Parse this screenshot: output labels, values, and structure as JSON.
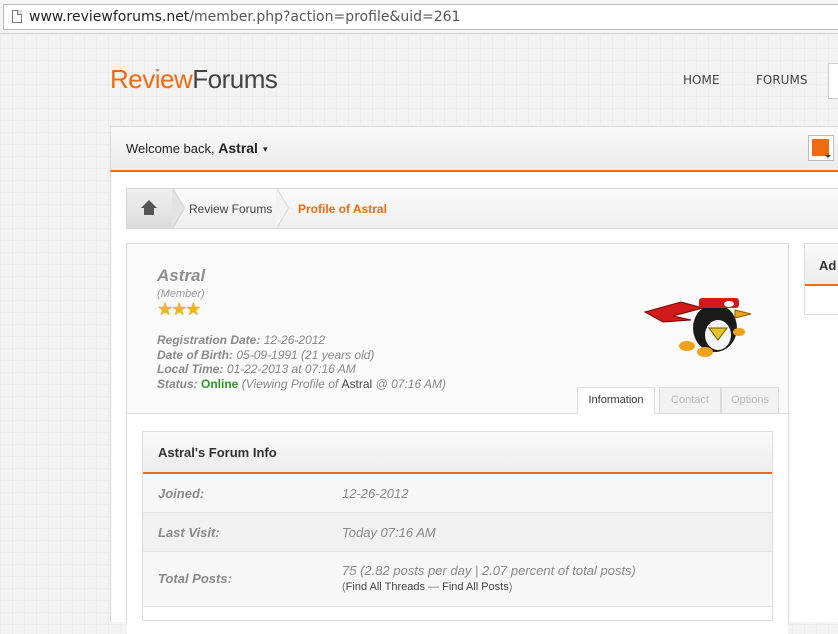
{
  "browser": {
    "url_host": "www.reviewforums.net",
    "url_path": "/member.php?action=profile&uid=261"
  },
  "site": {
    "logo_part1": "Review",
    "logo_part2": "Forums",
    "nav": [
      "HOME",
      "FORUMS"
    ],
    "accent_color": "#f26a10"
  },
  "welcome": {
    "prefix": "Welcome back,",
    "username": "Astral",
    "caret": "▾"
  },
  "breadcrumb": {
    "items": [
      "Review Forums",
      "Profile of Astral"
    ]
  },
  "profile": {
    "name": "Astral",
    "rank": "(Member)",
    "stars": "★★★",
    "star_count": 3,
    "registration_label": "Registration Date:",
    "registration_value": "12-26-2012",
    "dob_label": "Date of Birth:",
    "dob_value": "05-09-1991 (21 years old)",
    "localtime_label": "Local Time:",
    "localtime_value": "01-22-2013 at 07:16 AM",
    "status_label": "Status:",
    "status_value": "Online",
    "status_detail_prefix": "(Viewing Profile of",
    "status_detail_user": "Astral",
    "status_detail_suffix": "@ 07:16 AM)",
    "tabs": [
      "Information",
      "Contact",
      "Options"
    ]
  },
  "forum_info": {
    "title": "Astral's Forum Info",
    "joined_label": "Joined:",
    "joined_value": "12-26-2012",
    "last_visit_label": "Last Visit:",
    "last_visit_value": "Today 07:16 AM",
    "total_posts_label": "Total Posts:",
    "total_posts_value": "75 (2.82 posts per day | 2.07 percent of total posts)",
    "find_threads": "Find All Threads",
    "find_posts": "Find All Posts",
    "dash": "—"
  },
  "sidebar": {
    "box_title": "Ad"
  }
}
